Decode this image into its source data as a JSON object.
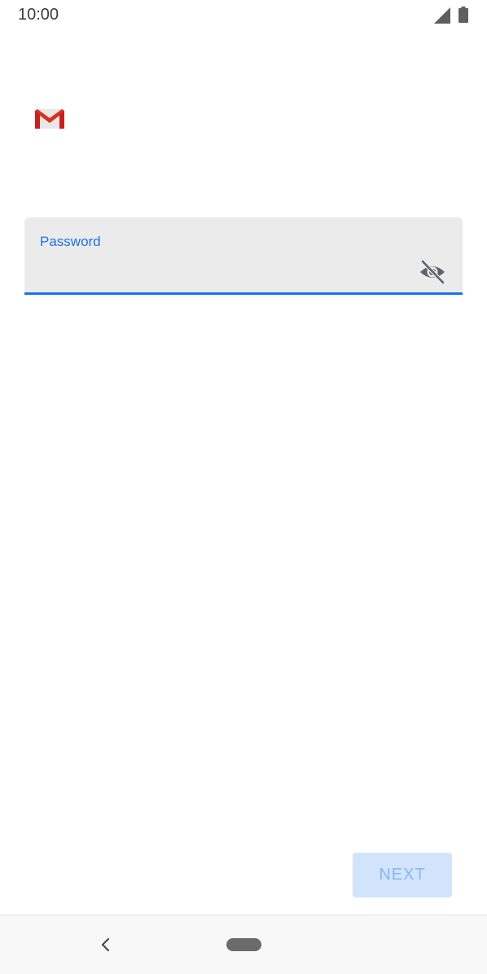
{
  "status_bar": {
    "time": "10:00",
    "signal_icon": "cellular-signal-icon",
    "battery_icon": "battery-icon"
  },
  "app": {
    "logo_icon": "gmail-logo-icon"
  },
  "password_field": {
    "label": "Password",
    "value": "",
    "placeholder": "",
    "toggle_icon": "visibility-off-icon",
    "accent_color": "#1a73e8"
  },
  "actions": {
    "next_label": "NEXT",
    "next_enabled": false
  },
  "nav_bar": {
    "back_icon": "back-chevron-icon",
    "home_icon": "home-pill-icon"
  }
}
